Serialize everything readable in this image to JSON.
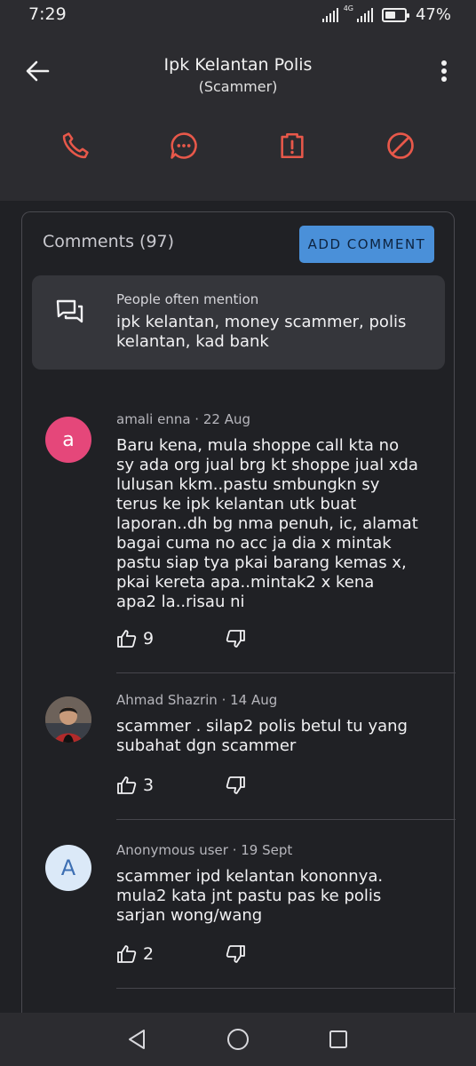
{
  "status_bar": {
    "time": "7:29",
    "network": "4G",
    "battery": "47%"
  },
  "header": {
    "title": "Ipk Kelantan Polis",
    "subtitle": "(Scammer)"
  },
  "actions": [
    "phone-icon",
    "message-icon",
    "report-icon",
    "block-icon"
  ],
  "accent_color": "#e8584a",
  "comments": {
    "title": "Comments (97)",
    "add_label": "ADD COMMENT",
    "mentions_heading": "People often mention",
    "mentions_text": "ipk kelantan, money scammer, polis kelantan, kad bank",
    "items": [
      {
        "avatar": "a",
        "avatar_color": "#e5477a",
        "meta": "amali enna · 22 Aug",
        "text": "Baru kena, mula shoppe call kta no sy ada org jual brg kt shoppe jual xda lulusan kkm..pastu smbungkn sy terus ke ipk kelantan utk buat laporan..dh bg nma penuh, ic, alamat bagai cuma no acc ja dia x mintak pastu siap tya pkai barang kemas x, pkai kereta apa..mintak2 x kena apa2 la..risau ni",
        "likes": "9"
      },
      {
        "avatar": "",
        "avatar_color": "#5a4a3e",
        "meta": "Ahmad Shazrin · 14 Aug",
        "text": "scammer . silap2 polis betul tu yang subahat dgn scammer",
        "likes": "3"
      },
      {
        "avatar": "A",
        "avatar_color": "#dbe9f8",
        "meta": "Anonymous user · 19 Sept",
        "text": "scammer ipd kelantan kononnya. mula2 kata jnt pastu pas ke polis sarjan wong/wang",
        "likes": "2"
      }
    ]
  }
}
